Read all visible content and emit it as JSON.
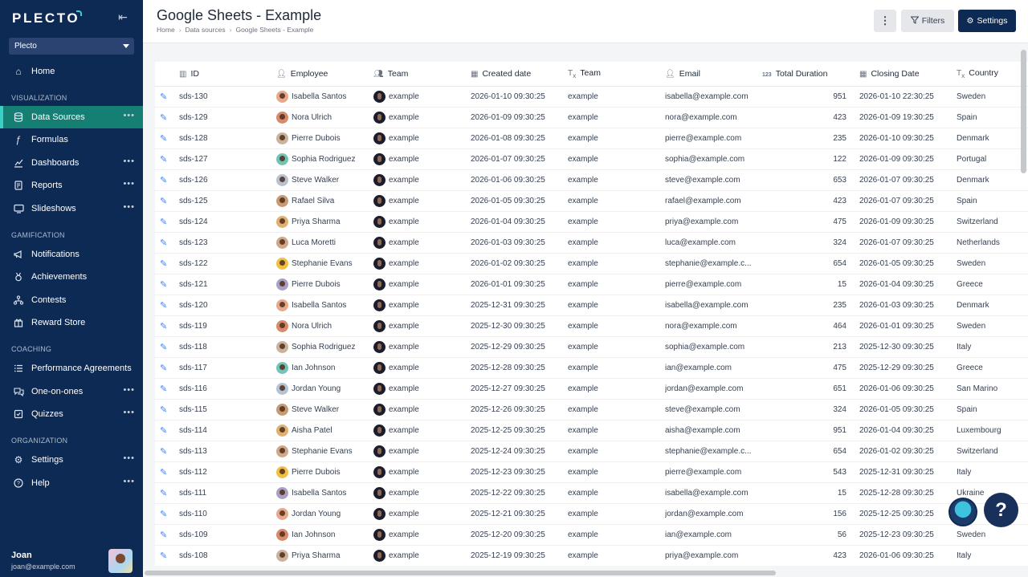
{
  "sidebar": {
    "logo": "PLECTO",
    "org": "Plecto",
    "home": "Home",
    "sections": {
      "visualization": "VISUALIZATION",
      "gamification": "GAMIFICATION",
      "coaching": "COACHING",
      "organization": "ORGANIZATION"
    },
    "items": {
      "data_sources": "Data Sources",
      "formulas": "Formulas",
      "dashboards": "Dashboards",
      "reports": "Reports",
      "slideshows": "Slideshows",
      "notifications": "Notifications",
      "achievements": "Achievements",
      "contests": "Contests",
      "reward_store": "Reward Store",
      "performance_agreements": "Performance Agreements",
      "one_on_ones": "One-on-ones",
      "quizzes": "Quizzes",
      "settings": "Settings",
      "help": "Help"
    },
    "user": {
      "name": "Joan",
      "email": "joan@example.com"
    }
  },
  "header": {
    "title": "Google Sheets - Example",
    "breadcrumb": [
      "Home",
      "Data sources",
      "Google Sheets - Example"
    ],
    "filters_label": "Filters",
    "settings_label": "Settings",
    "more_label": "⋮"
  },
  "table": {
    "columns": [
      "ID",
      "Employee",
      "Team",
      "Created date",
      "Team",
      "Email",
      "Total Duration",
      "Closing Date",
      "Country"
    ],
    "rows": [
      [
        "sds-130",
        "Isabella Santos",
        "example",
        "2026-01-10 09:30:25",
        "example",
        "isabella@example.com",
        "951",
        "2026-01-10 22:30:25",
        "Sweden"
      ],
      [
        "sds-129",
        "Nora Ulrich",
        "example",
        "2026-01-09 09:30:25",
        "example",
        "nora@example.com",
        "423",
        "2026-01-09 19:30:25",
        "Spain"
      ],
      [
        "sds-128",
        "Pierre Dubois",
        "example",
        "2026-01-08 09:30:25",
        "example",
        "pierre@example.com",
        "235",
        "2026-01-10 09:30:25",
        "Denmark"
      ],
      [
        "sds-127",
        "Sophia Rodriguez",
        "example",
        "2026-01-07 09:30:25",
        "example",
        "sophia@example.com",
        "122",
        "2026-01-09 09:30:25",
        "Portugal"
      ],
      [
        "sds-126",
        "Steve Walker",
        "example",
        "2026-01-06 09:30:25",
        "example",
        "steve@example.com",
        "653",
        "2026-01-07 09:30:25",
        "Denmark"
      ],
      [
        "sds-125",
        "Rafael Silva",
        "example",
        "2026-01-05 09:30:25",
        "example",
        "rafael@example.com",
        "423",
        "2026-01-07 09:30:25",
        "Spain"
      ],
      [
        "sds-124",
        "Priya Sharma",
        "example",
        "2026-01-04 09:30:25",
        "example",
        "priya@example.com",
        "475",
        "2026-01-09 09:30:25",
        "Switzerland"
      ],
      [
        "sds-123",
        "Luca Moretti",
        "example",
        "2026-01-03 09:30:25",
        "example",
        "luca@example.com",
        "324",
        "2026-01-07 09:30:25",
        "Netherlands"
      ],
      [
        "sds-122",
        "Stephanie Evans",
        "example",
        "2026-01-02 09:30:25",
        "example",
        "stephanie@example.c...",
        "654",
        "2026-01-05 09:30:25",
        "Sweden"
      ],
      [
        "sds-121",
        "Pierre Dubois",
        "example",
        "2026-01-01 09:30:25",
        "example",
        "pierre@example.com",
        "15",
        "2026-01-04 09:30:25",
        "Greece"
      ],
      [
        "sds-120",
        "Isabella Santos",
        "example",
        "2025-12-31 09:30:25",
        "example",
        "isabella@example.com",
        "235",
        "2026-01-03 09:30:25",
        "Denmark"
      ],
      [
        "sds-119",
        "Nora Ulrich",
        "example",
        "2025-12-30 09:30:25",
        "example",
        "nora@example.com",
        "464",
        "2026-01-01 09:30:25",
        "Sweden"
      ],
      [
        "sds-118",
        "Sophia Rodriguez",
        "example",
        "2025-12-29 09:30:25",
        "example",
        "sophia@example.com",
        "213",
        "2025-12-30 09:30:25",
        "Italy"
      ],
      [
        "sds-117",
        "Ian Johnson",
        "example",
        "2025-12-28 09:30:25",
        "example",
        "ian@example.com",
        "475",
        "2025-12-29 09:30:25",
        "Greece"
      ],
      [
        "sds-116",
        "Jordan Young",
        "example",
        "2025-12-27 09:30:25",
        "example",
        "jordan@example.com",
        "651",
        "2026-01-06 09:30:25",
        "San Marino"
      ],
      [
        "sds-115",
        "Steve Walker",
        "example",
        "2025-12-26 09:30:25",
        "example",
        "steve@example.com",
        "324",
        "2026-01-05 09:30:25",
        "Spain"
      ],
      [
        "sds-114",
        "Aisha Patel",
        "example",
        "2025-12-25 09:30:25",
        "example",
        "aisha@example.com",
        "951",
        "2026-01-04 09:30:25",
        "Luxembourg"
      ],
      [
        "sds-113",
        "Stephanie Evans",
        "example",
        "2025-12-24 09:30:25",
        "example",
        "stephanie@example.c...",
        "654",
        "2026-01-02 09:30:25",
        "Switzerland"
      ],
      [
        "sds-112",
        "Pierre Dubois",
        "example",
        "2025-12-23 09:30:25",
        "example",
        "pierre@example.com",
        "543",
        "2025-12-31 09:30:25",
        "Italy"
      ],
      [
        "sds-111",
        "Isabella Santos",
        "example",
        "2025-12-22 09:30:25",
        "example",
        "isabella@example.com",
        "15",
        "2025-12-28 09:30:25",
        "Ukraine"
      ],
      [
        "sds-110",
        "Jordan Young",
        "example",
        "2025-12-21 09:30:25",
        "example",
        "jordan@example.com",
        "156",
        "2025-12-25 09:30:25",
        ""
      ],
      [
        "sds-109",
        "Ian Johnson",
        "example",
        "2025-12-20 09:30:25",
        "example",
        "ian@example.com",
        "56",
        "2025-12-23 09:30:25",
        "Sweden"
      ],
      [
        "sds-108",
        "Priya Sharma",
        "example",
        "2025-12-19 09:30:25",
        "example",
        "priya@example.com",
        "423",
        "2026-01-06 09:30:25",
        "Italy"
      ]
    ]
  },
  "help_label": "?"
}
